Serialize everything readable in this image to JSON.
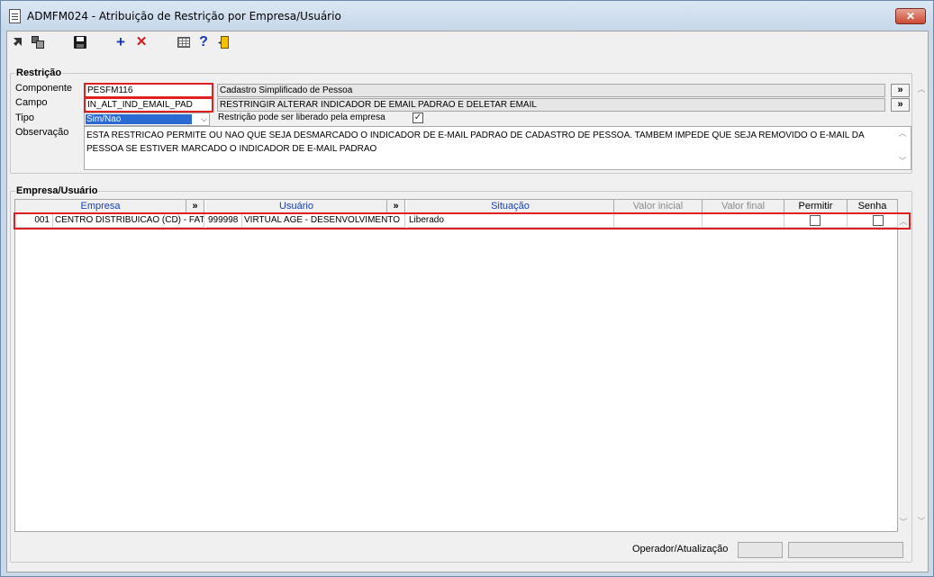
{
  "window": {
    "title": "ADMFM024 - Atribuição de Restrição por Empresa/Usuário",
    "close_label": "✕"
  },
  "toolbar": {
    "add_label": "+",
    "delete_label": "✕",
    "help_label": "?"
  },
  "restricao": {
    "group_title": "Restrição",
    "componente_label": "Componente",
    "componente_value": "PESFM116",
    "componente_desc": "Cadastro Simplificado de Pessoa",
    "campo_label": "Campo",
    "campo_value": "IN_ALT_IND_EMAIL_PAD",
    "campo_desc": "RESTRINGIR ALTERAR INDICADOR DE EMAIL PADRAO E DELETAR EMAIL",
    "tipo_label": "Tipo",
    "tipo_value": "Sim/Nao",
    "liberado_label": "Restrição pode ser liberado pela empresa",
    "liberado_checked": true,
    "observacao_label": "Observação",
    "observacao_value": "ESTA RESTRICAO PERMITE OU NAO QUE SEJA DESMARCADO O INDICADOR DE E-MAIL PADRAO DE CADASTRO DE PESSOA. TAMBEM IMPEDE QUE SEJA REMOVIDO O E-MAIL DA PESSOA SE ESTIVER MARCADO O INDICADOR DE E-MAIL PADRAO",
    "lookup_label": "»"
  },
  "empresa_usuario": {
    "group_title": "Empresa/Usuário",
    "columns": {
      "empresa": "Empresa",
      "usuario": "Usuário",
      "situacao": "Situação",
      "valor_inicial": "Valor inicial",
      "valor_final": "Valor final",
      "permitir": "Permitir",
      "senha": "Senha",
      "lookup": "»"
    },
    "rows": [
      {
        "empresa_code": "001",
        "empresa_name": "CENTRO DISTRIBUICAO (CD) - FAT",
        "usuario_code": "999998",
        "usuario_name": "VIRTUAL AGE - DESENVOLVIMENTO",
        "situacao": "Liberado",
        "valor_inicial": "",
        "valor_final": "",
        "permitir": false,
        "senha": false
      }
    ]
  },
  "footer": {
    "operador_label": "Operador/Atualização",
    "operador_value": "",
    "atualizacao_value": ""
  },
  "colors": {
    "highlight": "#e02020",
    "selection": "#2a6ad2",
    "header_blue": "#1b3fae"
  }
}
